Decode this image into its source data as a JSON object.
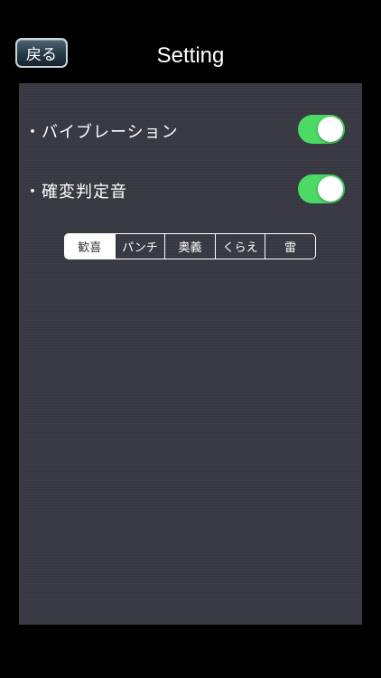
{
  "header": {
    "back_label": "戻る",
    "title": "Setting"
  },
  "settings": [
    {
      "label": "・バイブレーション",
      "enabled": true
    },
    {
      "label": "・確変判定音",
      "enabled": true
    }
  ],
  "sound_selector": {
    "options": [
      "歓喜",
      "パンチ",
      "奥義",
      "くらえ",
      "雷"
    ],
    "selected": "歓喜"
  },
  "colors": {
    "toggle_on": "#4cd964",
    "panel_background": "#383943"
  }
}
